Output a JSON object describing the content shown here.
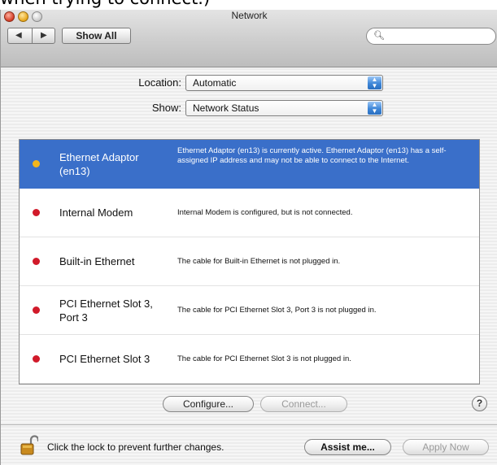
{
  "caption": "when trying to connect.)",
  "window": {
    "title": "Network",
    "toolbar": {
      "back_icon": "triangle-left-icon",
      "forward_icon": "triangle-right-icon",
      "show_all_label": "Show All",
      "search_value": "",
      "search_placeholder": ""
    }
  },
  "location": {
    "label": "Location:",
    "value": "Automatic"
  },
  "show": {
    "label": "Show:",
    "value": "Network Status"
  },
  "services": [
    {
      "name": "Ethernet Adaptor (en13)",
      "status_color": "#f3b51b",
      "selected": true,
      "description": "Ethernet Adaptor (en13) is currently active. Ethernet Adaptor (en13) has a self-assigned IP address and may not be able to connect to the Internet."
    },
    {
      "name": "Internal Modem",
      "status_color": "#d11a2a",
      "selected": false,
      "description": "Internal Modem is configured, but is not connected."
    },
    {
      "name": "Built-in Ethernet",
      "status_color": "#d11a2a",
      "selected": false,
      "description": "The cable for Built-in Ethernet is not plugged in."
    },
    {
      "name": "PCI Ethernet Slot 3, Port 3",
      "status_color": "#d11a2a",
      "selected": false,
      "description": "The cable for PCI Ethernet Slot 3, Port 3 is not plugged in."
    },
    {
      "name": "PCI Ethernet Slot 3",
      "status_color": "#d11a2a",
      "selected": false,
      "description": "The cable for PCI Ethernet Slot 3 is not plugged in."
    }
  ],
  "buttons": {
    "configure": "Configure...",
    "connect": "Connect...",
    "help": "?",
    "assist": "Assist me...",
    "apply": "Apply Now"
  },
  "lock": {
    "text": "Click the lock to prevent further changes."
  },
  "colors": {
    "selection": "#3a6fc9",
    "active_dot": "#f3b51b",
    "inactive_dot": "#d11a2a"
  }
}
